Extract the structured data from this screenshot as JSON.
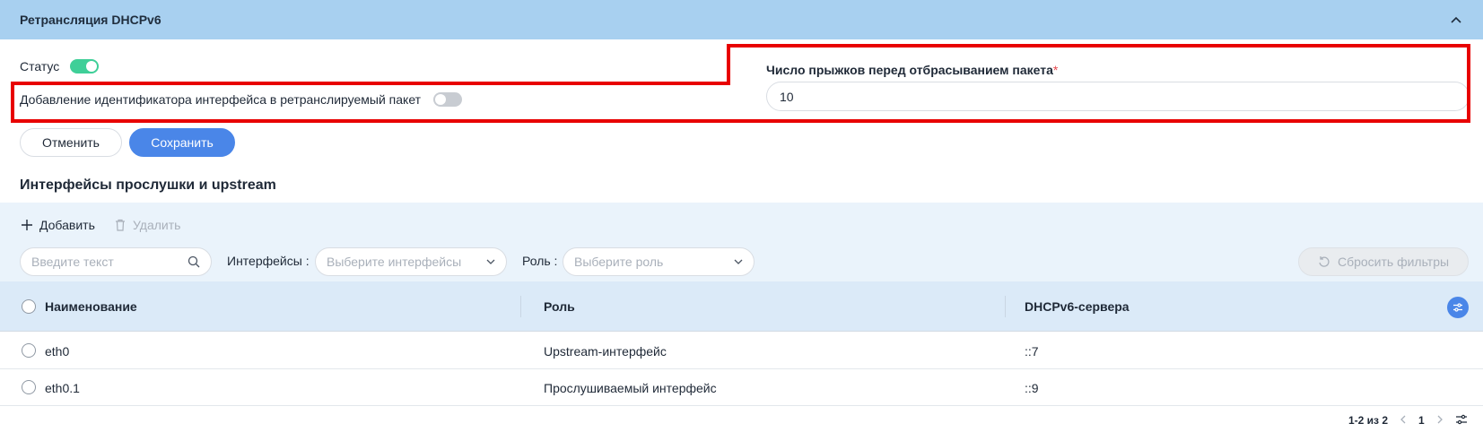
{
  "section": {
    "title": "Ретрансляция DHCPv6"
  },
  "form": {
    "status_label": "Статус",
    "status_on": true,
    "iface_id_label": "Добавление идентификатора интерфейса в ретранслируемый пакет",
    "iface_id_on": false,
    "hops_label": "Число прыжков перед отбрасыванием пакета",
    "hops_required_mark": "*",
    "hops_value": "10",
    "cancel_label": "Отменить",
    "save_label": "Сохранить"
  },
  "interfaces": {
    "title": "Интерфейсы прослушки и upstream",
    "add_label": "Добавить",
    "delete_label": "Удалить",
    "search_placeholder": "Введите текст",
    "filter_interfaces_label": "Интерфейсы :",
    "filter_interfaces_placeholder": "Выберите интерфейсы",
    "filter_role_label": "Роль :",
    "filter_role_placeholder": "Выберите роль",
    "reset_filters_label": "Сбросить фильтры",
    "columns": [
      "Наименование",
      "Роль",
      "DHCPv6-сервера"
    ],
    "rows": [
      {
        "name": "eth0",
        "role": "Upstream-интерфейс",
        "servers": "::7"
      },
      {
        "name": "eth0.1",
        "role": "Прослушиваемый интерфейс",
        "servers": "::9"
      }
    ],
    "pager": {
      "range": "1-2 из 2",
      "page": "1"
    }
  },
  "colors": {
    "header_bg": "#a8d0f0",
    "accent": "#4a86e8",
    "toggle_on": "#3fcf98",
    "highlight_box": "#e80000"
  }
}
